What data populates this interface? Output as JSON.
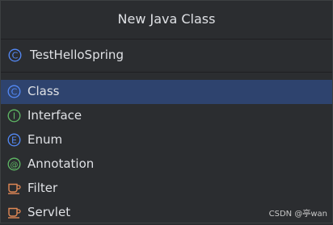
{
  "dialog": {
    "title": "New Java Class",
    "name_value": "TestHelloSpring",
    "name_icon": "class-icon"
  },
  "kinds": [
    {
      "label": "Class",
      "icon": "class-icon",
      "selected": true
    },
    {
      "label": "Interface",
      "icon": "interface-icon",
      "selected": false
    },
    {
      "label": "Enum",
      "icon": "enum-icon",
      "selected": false
    },
    {
      "label": "Annotation",
      "icon": "annotation-icon",
      "selected": false
    },
    {
      "label": "Filter",
      "icon": "filter-icon",
      "selected": false
    },
    {
      "label": "Servlet",
      "icon": "servlet-icon",
      "selected": false
    }
  ],
  "watermark": "CSDN @亭wan",
  "colors": {
    "background": "#2b2d30",
    "selection": "#2e436e",
    "class_icon": "#548af7",
    "interface_icon": "#5fb865",
    "enum_icon": "#548af7",
    "annotation_icon": "#5fb865",
    "filter_servlet_icon": "#e08855"
  }
}
